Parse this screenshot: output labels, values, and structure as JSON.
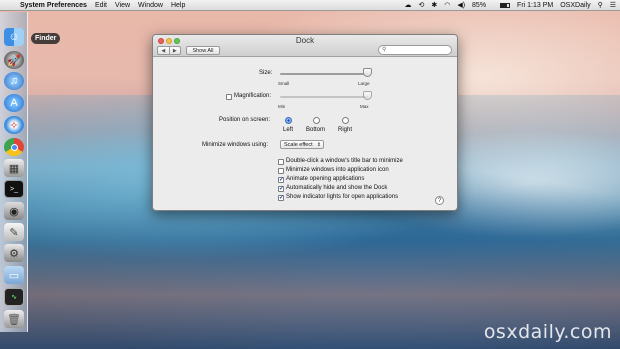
{
  "menubar": {
    "app": "System Preferences",
    "menus": [
      "Edit",
      "View",
      "Window",
      "Help"
    ],
    "battery": "85%",
    "clock": "Fri 1:13 PM",
    "user": "OSXDaily"
  },
  "dock": {
    "tooltip": "Finder",
    "items": [
      "finder-icon",
      "launchpad-icon",
      "itunes-icon",
      "app-store-icon",
      "safari-icon",
      "chrome-icon",
      "preview-icon",
      "terminal-icon",
      "boot-camp-icon",
      "textedit-icon",
      "grapher-icon",
      "applications-folder-icon",
      "activity-monitor-icon",
      "trash-icon"
    ]
  },
  "window": {
    "title": "Dock",
    "show_all": "Show All",
    "search_placeholder": ""
  },
  "dock_prefs": {
    "size_label": "Size:",
    "size_small": "Small",
    "size_large": "Large",
    "size_value": 1.0,
    "magnification_label": "Magnification:",
    "magnification_min": "Min",
    "magnification_max": "Max",
    "magnification_checked": false,
    "magnification_value": 1.0,
    "position_label": "Position on screen:",
    "positions": [
      "Left",
      "Bottom",
      "Right"
    ],
    "position_selected": "Left",
    "minimize_label": "Minimize windows using:",
    "minimize_effect": "Scale effect",
    "options": [
      {
        "label": "Double-click a window's title bar to minimize",
        "checked": false
      },
      {
        "label": "Minimize windows into application icon",
        "checked": false
      },
      {
        "label": "Animate opening applications",
        "checked": true
      },
      {
        "label": "Automatically hide and show the Dock",
        "checked": true
      },
      {
        "label": "Show indicator lights for open applications",
        "checked": true
      }
    ],
    "help": "?"
  },
  "watermark": "osxdaily.com"
}
